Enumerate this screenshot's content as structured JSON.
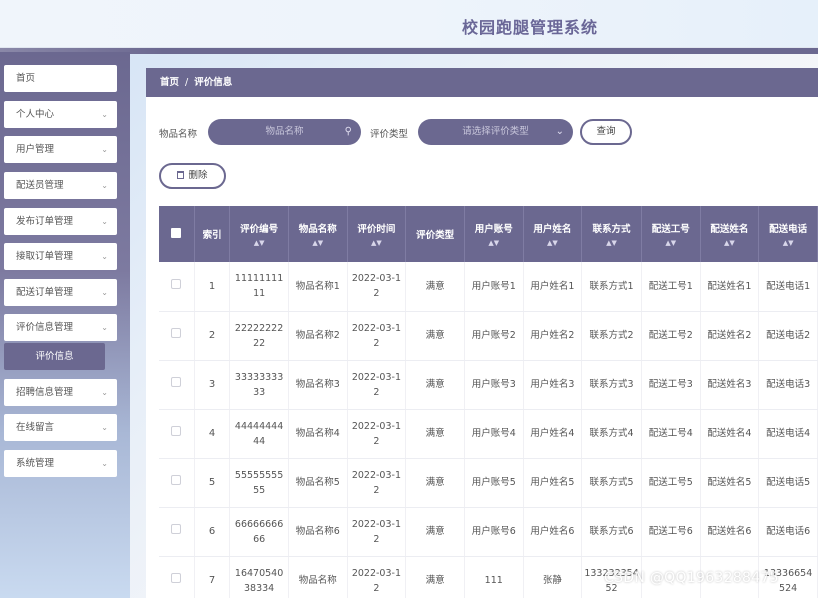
{
  "header": {
    "title": "校园跑腿管理系统"
  },
  "sidebar": {
    "items": [
      {
        "label": "首页",
        "chevron": false
      },
      {
        "label": "个人中心",
        "chevron": true
      },
      {
        "label": "用户管理",
        "chevron": true
      },
      {
        "label": "配送员管理",
        "chevron": true
      },
      {
        "label": "发布订单管理",
        "chevron": true
      },
      {
        "label": "接取订单管理",
        "chevron": true
      },
      {
        "label": "配送订单管理",
        "chevron": true
      },
      {
        "label": "评价信息管理",
        "chevron": true
      },
      {
        "label": "招聘信息管理",
        "chevron": true
      },
      {
        "label": "在线留言",
        "chevron": true
      },
      {
        "label": "系统管理",
        "chevron": true
      }
    ],
    "active_sub": "评价信息"
  },
  "breadcrumb": {
    "home": "首页",
    "sep": "/",
    "current": "评价信息"
  },
  "search": {
    "item_label": "物品名称",
    "item_placeholder": "物品名称",
    "type_label": "评价类型",
    "type_placeholder": "请选择评价类型",
    "query_button": "查询",
    "delete_button": "删除"
  },
  "table": {
    "columns": [
      "索引",
      "评价编号",
      "物品名称",
      "评价时间",
      "评价类型",
      "用户账号",
      "用户姓名",
      "联系方式",
      "配送工号",
      "配送姓名",
      "配送电话"
    ],
    "rows": [
      [
        "1",
        "1111111111",
        "物品名称1",
        "2022-03-12",
        "满意",
        "用户账号1",
        "用户姓名1",
        "联系方式1",
        "配送工号1",
        "配送姓名1",
        "配送电话1"
      ],
      [
        "2",
        "2222222222",
        "物品名称2",
        "2022-03-12",
        "满意",
        "用户账号2",
        "用户姓名2",
        "联系方式2",
        "配送工号2",
        "配送姓名2",
        "配送电话2"
      ],
      [
        "3",
        "3333333333",
        "物品名称3",
        "2022-03-12",
        "满意",
        "用户账号3",
        "用户姓名3",
        "联系方式3",
        "配送工号3",
        "配送姓名3",
        "配送电话3"
      ],
      [
        "4",
        "4444444444",
        "物品名称4",
        "2022-03-12",
        "满意",
        "用户账号4",
        "用户姓名4",
        "联系方式4",
        "配送工号4",
        "配送姓名4",
        "配送电话4"
      ],
      [
        "5",
        "5555555555",
        "物品名称5",
        "2022-03-12",
        "满意",
        "用户账号5",
        "用户姓名5",
        "联系方式5",
        "配送工号5",
        "配送姓名5",
        "配送电话5"
      ],
      [
        "6",
        "6666666666",
        "物品名称6",
        "2022-03-12",
        "满意",
        "用户账号6",
        "用户姓名6",
        "联系方式6",
        "配送工号6",
        "配送姓名6",
        "配送电话6"
      ],
      [
        "7",
        "1647054038334",
        "物品名称",
        "2022-03-12",
        "满意",
        "111",
        "张静",
        "13323235452",
        "",
        "",
        "13336654524"
      ]
    ]
  },
  "watermark": "CSDN @QQ1963288475",
  "colors": {
    "primary": "#6b6890",
    "white": "#ffffff"
  },
  "icons": {
    "search": "search-icon",
    "dropdown": "chevron-down-icon",
    "delete": "trash-icon",
    "sort": "sort-icon"
  }
}
